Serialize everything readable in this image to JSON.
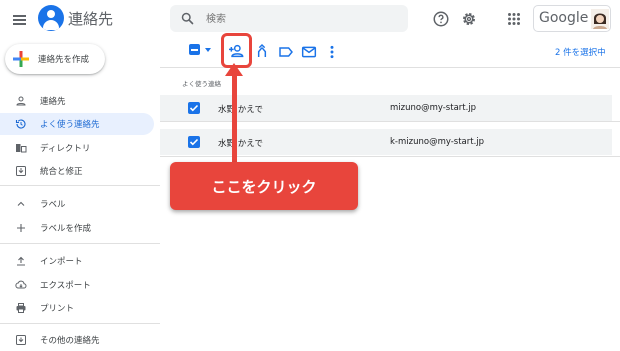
{
  "header": {
    "app_title": "連絡先",
    "search": {
      "placeholder": "検索",
      "value": ""
    },
    "google_label": "Google",
    "icons": [
      "menu-icon",
      "contacts-logo-icon",
      "search-icon",
      "help-icon",
      "settings-icon",
      "apps-icon",
      "account-avatar"
    ]
  },
  "sidebar": {
    "create_label": "連絡先を作成",
    "items": [
      {
        "label": "連絡先",
        "icon": "person-icon",
        "selected": false
      },
      {
        "label": "よく使う連絡先",
        "icon": "history-icon",
        "selected": true
      },
      {
        "label": "ディレクトリ",
        "icon": "directory-icon",
        "selected": false
      },
      {
        "label": "統合と修正",
        "icon": "merge-icon",
        "selected": false
      },
      {
        "label": "ラベル",
        "icon": "chevron-up-icon",
        "selected": false
      },
      {
        "label": "ラベルを作成",
        "icon": "plus-icon",
        "selected": false
      },
      {
        "label": "インポート",
        "icon": "upload-icon",
        "selected": false
      },
      {
        "label": "エクスポート",
        "icon": "cloud-download-icon",
        "selected": false
      },
      {
        "label": "プリント",
        "icon": "print-icon",
        "selected": false
      },
      {
        "label": "その他の連絡先",
        "icon": "other-contacts-icon",
        "selected": false
      }
    ]
  },
  "toolbar": {
    "selection_count": "2 件を選択中",
    "icons": [
      "select-all-checkbox",
      "select-dropdown-icon",
      "add-to-contacts-icon",
      "merge-icon",
      "label-icon",
      "email-icon",
      "more-vert-icon"
    ]
  },
  "list": {
    "section_label": "よく使う連絡",
    "rows": [
      {
        "name": "水野 かえで",
        "email": "mizuno@my-start.jp",
        "checked": true
      },
      {
        "name": "水野 かえで",
        "email": "k-mizuno@my-start.jp",
        "checked": true
      }
    ]
  },
  "annotation": {
    "callout_text": "ここをクリック",
    "color": "#e8453c"
  },
  "colors": {
    "accent": "#1a73e8",
    "selected_bg": "#e8f0fe",
    "row_bg": "#f1f3f4",
    "annotation": "#e8453c"
  }
}
